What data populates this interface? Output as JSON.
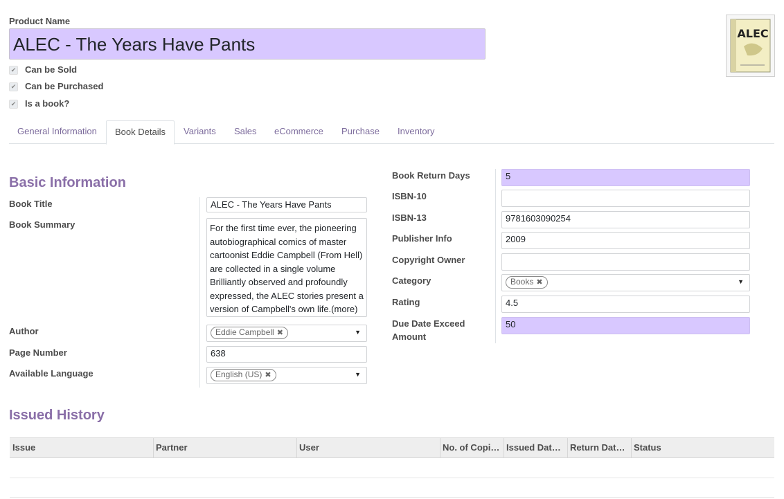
{
  "header": {
    "product_name_label": "Product Name",
    "product_name": "ALEC - The Years Have Pants",
    "checkboxes": [
      {
        "label": "Can be Sold",
        "checked": true
      },
      {
        "label": "Can be Purchased",
        "checked": true
      },
      {
        "label": "Is a book?",
        "checked": true
      }
    ],
    "image_text": "ALEC"
  },
  "tabs": [
    {
      "label": "General Information",
      "active": false
    },
    {
      "label": "Book Details",
      "active": true
    },
    {
      "label": "Variants",
      "active": false
    },
    {
      "label": "Sales",
      "active": false
    },
    {
      "label": "eCommerce",
      "active": false
    },
    {
      "label": "Purchase",
      "active": false
    },
    {
      "label": "Inventory",
      "active": false
    }
  ],
  "basic_info": {
    "title": "Basic Information",
    "book_title_label": "Book Title",
    "book_title": "ALEC - The Years Have Pants",
    "book_summary_label": "Book Summary",
    "book_summary": "For the first time ever, the pioneering autobiographical comics of master cartoonist Eddie Campbell (From Hell) are collected in a single volume Brilliantly observed and profoundly expressed, the ALEC stories present a version of Campbell's own life.(more)",
    "author_label": "Author",
    "author": "Eddie Campbell",
    "page_number_label": "Page Number",
    "page_number": "638",
    "language_label": "Available Language",
    "language": "English (US)"
  },
  "right_fields": {
    "return_days_label": "Book Return Days",
    "return_days": "5",
    "isbn10_label": "ISBN-10",
    "isbn10": "",
    "isbn13_label": "ISBN-13",
    "isbn13": "9781603090254",
    "publisher_label": "Publisher Info",
    "publisher": "2009",
    "copyright_label": "Copyright Owner",
    "copyright": "",
    "category_label": "Category",
    "category": "Books",
    "rating_label": "Rating",
    "rating": "4.5",
    "due_label_1": "Due Date Exceed",
    "due_label_2": "Amount",
    "due_amount": "50"
  },
  "issued_history": {
    "title": "Issued History",
    "columns": [
      "Issue",
      "Partner",
      "User",
      "No. of Copi…",
      "Issued Dat…",
      "Return Dat…",
      "Status"
    ]
  },
  "colors": {
    "accent": "#875a9b",
    "required_field": "#d8c8ff"
  },
  "icons": {
    "check": "check-icon",
    "remove_tag": "remove-tag-icon",
    "dropdown": "caret-down-icon"
  }
}
